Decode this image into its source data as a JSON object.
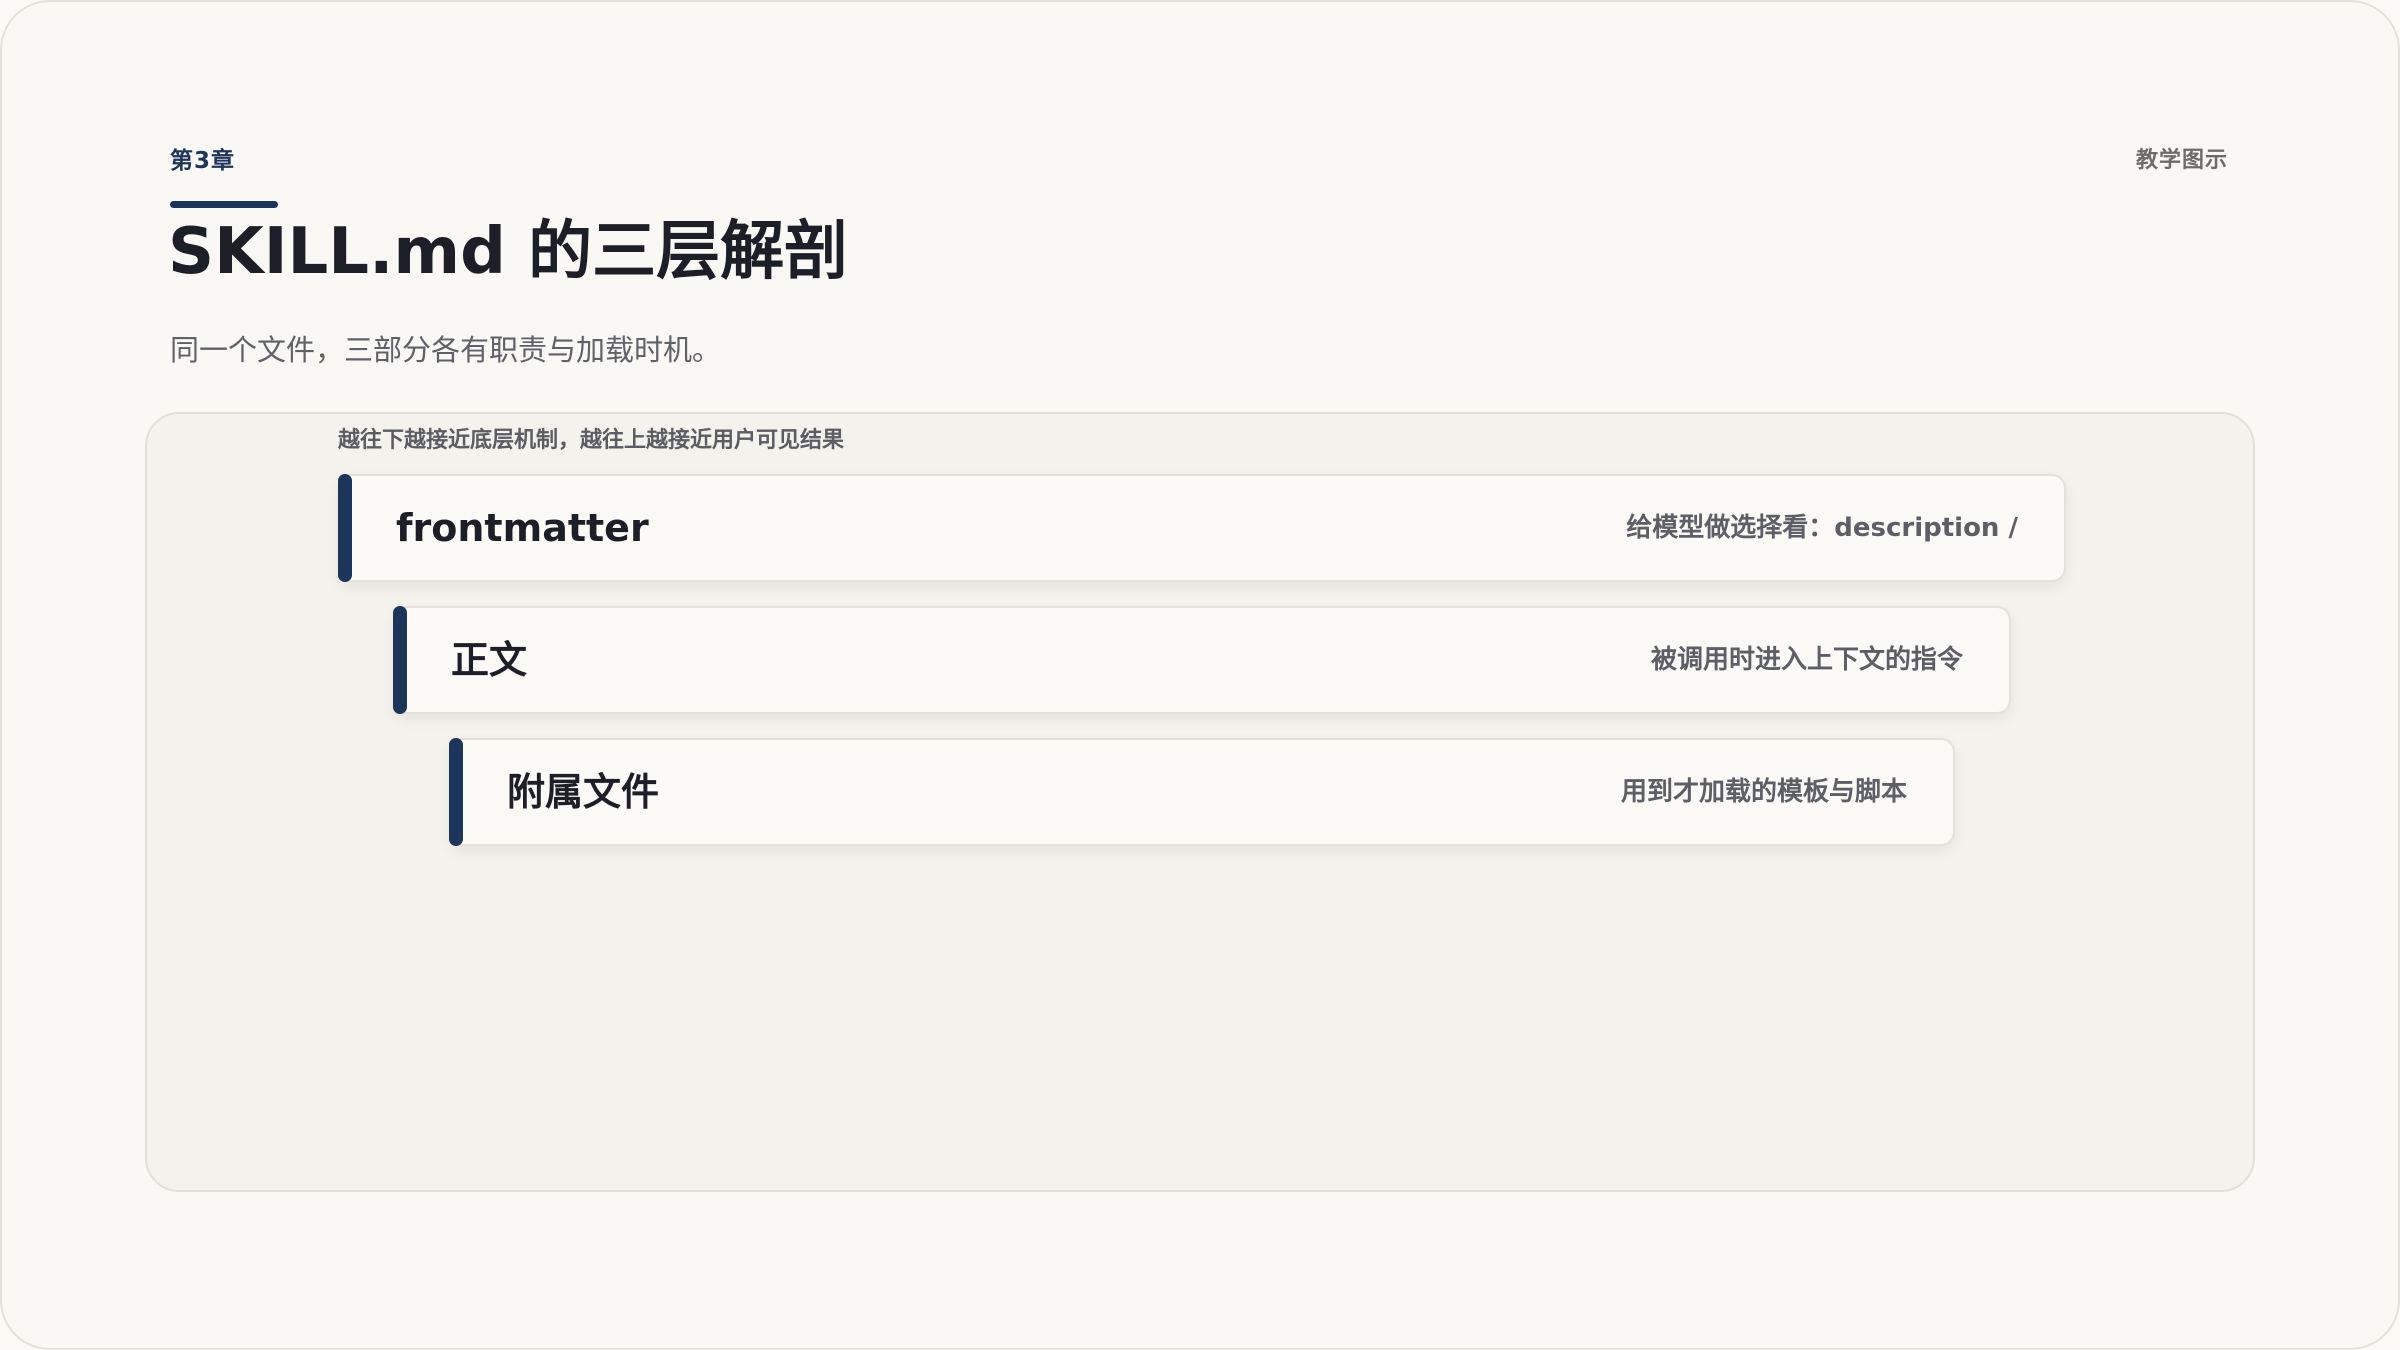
{
  "header": {
    "chapter": "第3章",
    "tag": "教学图示",
    "title": "SKILL.md 的三层解剖",
    "subtitle": "同一个文件，三部分各有职责与加载时机。"
  },
  "diagram": {
    "note": "越往下越接近底层机制，越往上越接近用户可见结果",
    "layers": [
      {
        "name": "frontmatter",
        "desc": "给模型做选择看：description /"
      },
      {
        "name": "正文",
        "desc": "被调用时进入上下文的指令"
      },
      {
        "name": "附属文件",
        "desc": "用到才加载的模板与脚本"
      }
    ]
  },
  "colors": {
    "accent": "#1d355a",
    "background": "#f9f8f4",
    "panel": "#f3f2ec"
  }
}
